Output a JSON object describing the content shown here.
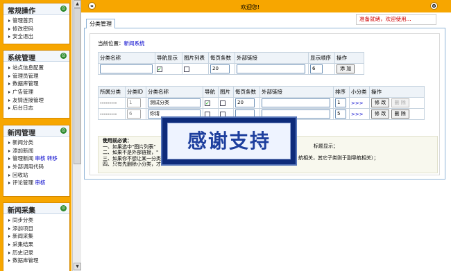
{
  "sidebar": {
    "sections": [
      {
        "title": "常规操作",
        "toggle": "⊙",
        "items": [
          {
            "label": "管理首页"
          },
          {
            "label": "修改密码"
          },
          {
            "label": "安全退出"
          }
        ]
      },
      {
        "title": "系统管理",
        "toggle": "⊙",
        "items": [
          {
            "label": "站点信息配置"
          },
          {
            "label": "管理员管理"
          },
          {
            "label": "数据库管理"
          },
          {
            "label": "广告管理"
          },
          {
            "label": "友情连接管理"
          },
          {
            "label": "后台日志"
          }
        ]
      },
      {
        "title": "新闻管理",
        "toggle": "⊙",
        "items": [
          {
            "label": "新闻分类"
          },
          {
            "label": "添加新闻"
          },
          {
            "label": "管理新闻",
            "extra1": "审核",
            "extra2": "转移"
          },
          {
            "label": "外部调用代码"
          },
          {
            "label": "回收站"
          },
          {
            "label": "评论管理",
            "extra1": "审核"
          }
        ]
      },
      {
        "title": "新闻采集",
        "toggle": "⊙",
        "items": [
          {
            "label": "同步分类"
          },
          {
            "label": "添加项目"
          },
          {
            "label": "新闻采集"
          },
          {
            "label": "采集结果"
          },
          {
            "label": "历史记录"
          },
          {
            "label": "数据库管理"
          }
        ]
      }
    ]
  },
  "topbar": {
    "left_button": "«",
    "welcome": "欢迎您!",
    "right_button": "⊗"
  },
  "status_message": "准备就绪，欢迎使用...",
  "tab": {
    "label": "分类管理"
  },
  "breadcrumb": {
    "prefix": "当前位置：",
    "link": "新闻系统"
  },
  "add_form": {
    "headers": [
      "分类名称",
      "导航显示",
      "图片列表",
      "每页条数",
      "外部链接",
      "显示顺序",
      "操作"
    ],
    "name_value": "",
    "nav_checked": "✓",
    "per_page": "20",
    "link_value": "",
    "order": "6",
    "add_button": "添 加"
  },
  "list": {
    "headers": [
      "所属分类",
      "分类ID",
      "分类名称",
      "导航",
      "图片",
      "每页条数",
      "外部链接",
      "排序",
      "小分类",
      "操作"
    ],
    "rows": [
      {
        "parent": "---------",
        "id": "1",
        "name": "测试分类",
        "nav": "✓",
        "img": "",
        "per_page": "20",
        "link": "",
        "order": "1",
        "sub": ">>>",
        "edit": "修 改",
        "delete": "删 除"
      },
      {
        "parent": "---------",
        "id": "6",
        "name": "你请",
        "nav": "",
        "img": "",
        "per_page": "",
        "link": "",
        "order": "5",
        "sub": ">>>",
        "edit": "修 改",
        "delete": "删 除"
      }
    ]
  },
  "notes": {
    "title": "使用前必读：",
    "lines": [
      "一、如果选中\"图片列表\"",
      "二、如果不是外部链接，\"",
      "三、如果你不想让某一分类",
      "四、只有先删除小分类，才"
    ],
    "right_lines": [
      "标题显示；",
      "航相关，其它子类则于副导航相关）；"
    ]
  },
  "overlay": {
    "text": "感谢支持"
  },
  "scrollbar": {
    "up": "▲",
    "down": "▼"
  }
}
